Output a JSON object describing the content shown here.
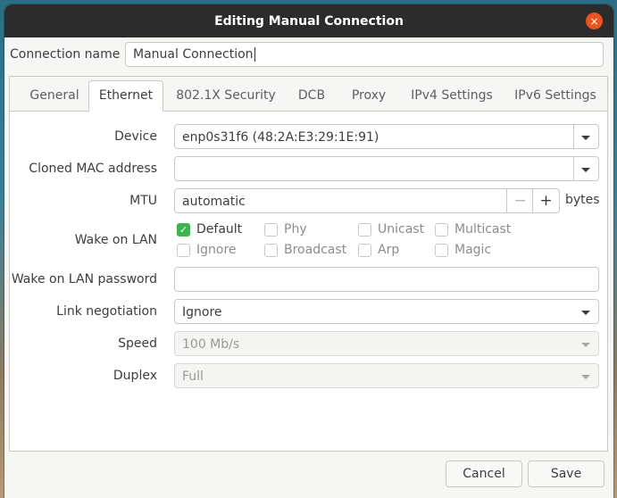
{
  "window": {
    "title": "Editing Manual Connection",
    "close_icon": "×"
  },
  "connection_name": {
    "label": "Connection name",
    "value": "Manual Connection"
  },
  "tabs": [
    {
      "label": "General",
      "active": false
    },
    {
      "label": "Ethernet",
      "active": true
    },
    {
      "label": "802.1X Security",
      "active": false
    },
    {
      "label": "DCB",
      "active": false
    },
    {
      "label": "Proxy",
      "active": false
    },
    {
      "label": "IPv4 Settings",
      "active": false
    },
    {
      "label": "IPv6 Settings",
      "active": false
    }
  ],
  "ethernet": {
    "device": {
      "label": "Device",
      "value": "enp0s31f6 (48:2A:E3:29:1E:91)"
    },
    "cloned_mac": {
      "label": "Cloned MAC address",
      "value": ""
    },
    "mtu": {
      "label": "MTU",
      "value": "automatic",
      "minus": "−",
      "plus": "+",
      "unit": "bytes"
    },
    "wake_on_lan": {
      "label": "Wake on LAN",
      "options": [
        {
          "label": "Default",
          "checked": true
        },
        {
          "label": "Phy",
          "checked": false
        },
        {
          "label": "Unicast",
          "checked": false
        },
        {
          "label": "Multicast",
          "checked": false
        },
        {
          "label": "Ignore",
          "checked": false
        },
        {
          "label": "Broadcast",
          "checked": false
        },
        {
          "label": "Arp",
          "checked": false
        },
        {
          "label": "Magic",
          "checked": false
        }
      ],
      "check_glyph": "✓"
    },
    "wol_password": {
      "label": "Wake on LAN password",
      "value": ""
    },
    "link_negotiation": {
      "label": "Link negotiation",
      "value": "Ignore"
    },
    "speed": {
      "label": "Speed",
      "value": "100 Mb/s",
      "disabled": true
    },
    "duplex": {
      "label": "Duplex",
      "value": "Full",
      "disabled": true
    }
  },
  "buttons": {
    "cancel": "Cancel",
    "save": "Save"
  }
}
